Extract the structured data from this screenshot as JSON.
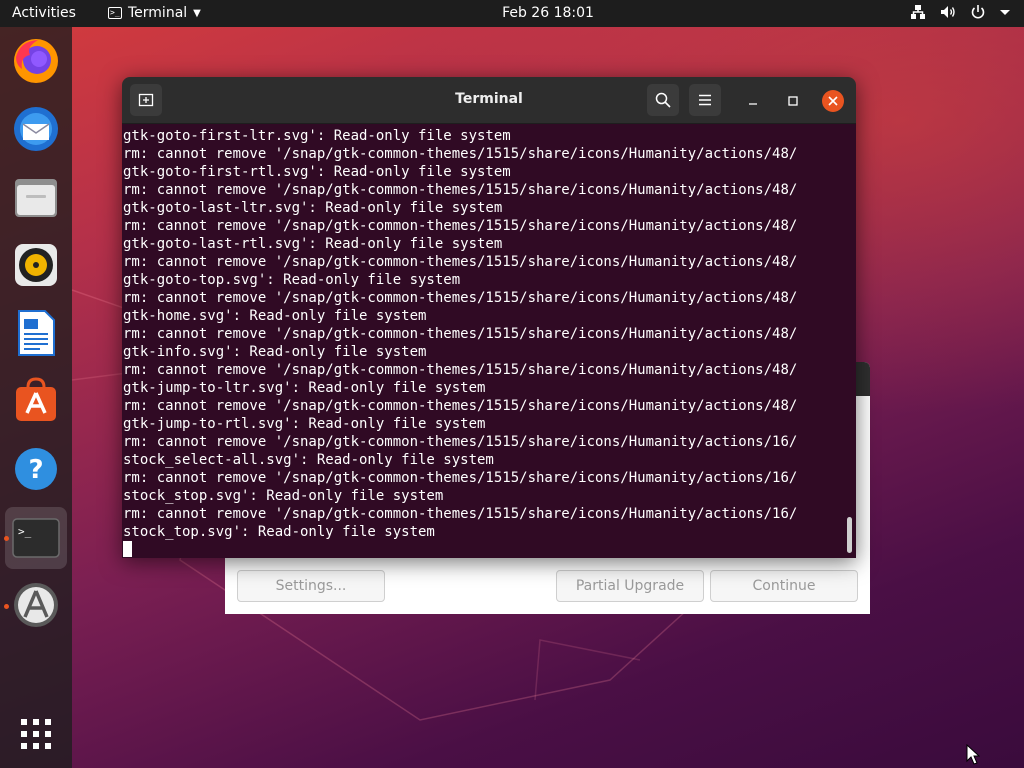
{
  "topbar": {
    "activities": "Activities",
    "app_name": "Terminal",
    "clock": "Feb 26  18:01",
    "icons": [
      "network-icon",
      "volume-icon",
      "power-icon",
      "chevron-down-icon"
    ]
  },
  "dock": {
    "items": [
      {
        "name": "firefox",
        "icon": "firefox-icon"
      },
      {
        "name": "thunderbird",
        "icon": "thunderbird-icon"
      },
      {
        "name": "files",
        "icon": "files-icon"
      },
      {
        "name": "rhythmbox",
        "icon": "rhythmbox-icon"
      },
      {
        "name": "libreoffice-writer",
        "icon": "writer-icon"
      },
      {
        "name": "ubuntu-software",
        "icon": "software-icon"
      },
      {
        "name": "help",
        "icon": "help-icon"
      },
      {
        "name": "terminal",
        "icon": "terminal-icon",
        "active": true
      },
      {
        "name": "software-updater",
        "icon": "updater-icon"
      }
    ],
    "show_apps_icon": "grid-icon"
  },
  "terminal": {
    "title": "Terminal",
    "lines": [
      "gtk-goto-first-ltr.svg': Read-only file system",
      "rm: cannot remove '/snap/gtk-common-themes/1515/share/icons/Humanity/actions/48/",
      "gtk-goto-first-rtl.svg': Read-only file system",
      "rm: cannot remove '/snap/gtk-common-themes/1515/share/icons/Humanity/actions/48/",
      "gtk-goto-last-ltr.svg': Read-only file system",
      "rm: cannot remove '/snap/gtk-common-themes/1515/share/icons/Humanity/actions/48/",
      "gtk-goto-last-rtl.svg': Read-only file system",
      "rm: cannot remove '/snap/gtk-common-themes/1515/share/icons/Humanity/actions/48/",
      "gtk-goto-top.svg': Read-only file system",
      "rm: cannot remove '/snap/gtk-common-themes/1515/share/icons/Humanity/actions/48/",
      "gtk-home.svg': Read-only file system",
      "rm: cannot remove '/snap/gtk-common-themes/1515/share/icons/Humanity/actions/48/",
      "gtk-info.svg': Read-only file system",
      "rm: cannot remove '/snap/gtk-common-themes/1515/share/icons/Humanity/actions/48/",
      "gtk-jump-to-ltr.svg': Read-only file system",
      "rm: cannot remove '/snap/gtk-common-themes/1515/share/icons/Humanity/actions/48/",
      "gtk-jump-to-rtl.svg': Read-only file system",
      "rm: cannot remove '/snap/gtk-common-themes/1515/share/icons/Humanity/actions/16/",
      "stock_select-all.svg': Read-only file system",
      "rm: cannot remove '/snap/gtk-common-themes/1515/share/icons/Humanity/actions/16/",
      "stock_stop.svg': Read-only file system",
      "rm: cannot remove '/snap/gtk-common-themes/1515/share/icons/Humanity/actions/16/",
      "stock_top.svg': Read-only file system"
    ]
  },
  "updater": {
    "settings_label": "Settings...",
    "partial_upgrade_label": "Partial Upgrade",
    "continue_label": "Continue"
  },
  "colors": {
    "terminal_bg": "#300a24",
    "accent": "#e95420",
    "topbar_bg": "#1d1d1d"
  }
}
